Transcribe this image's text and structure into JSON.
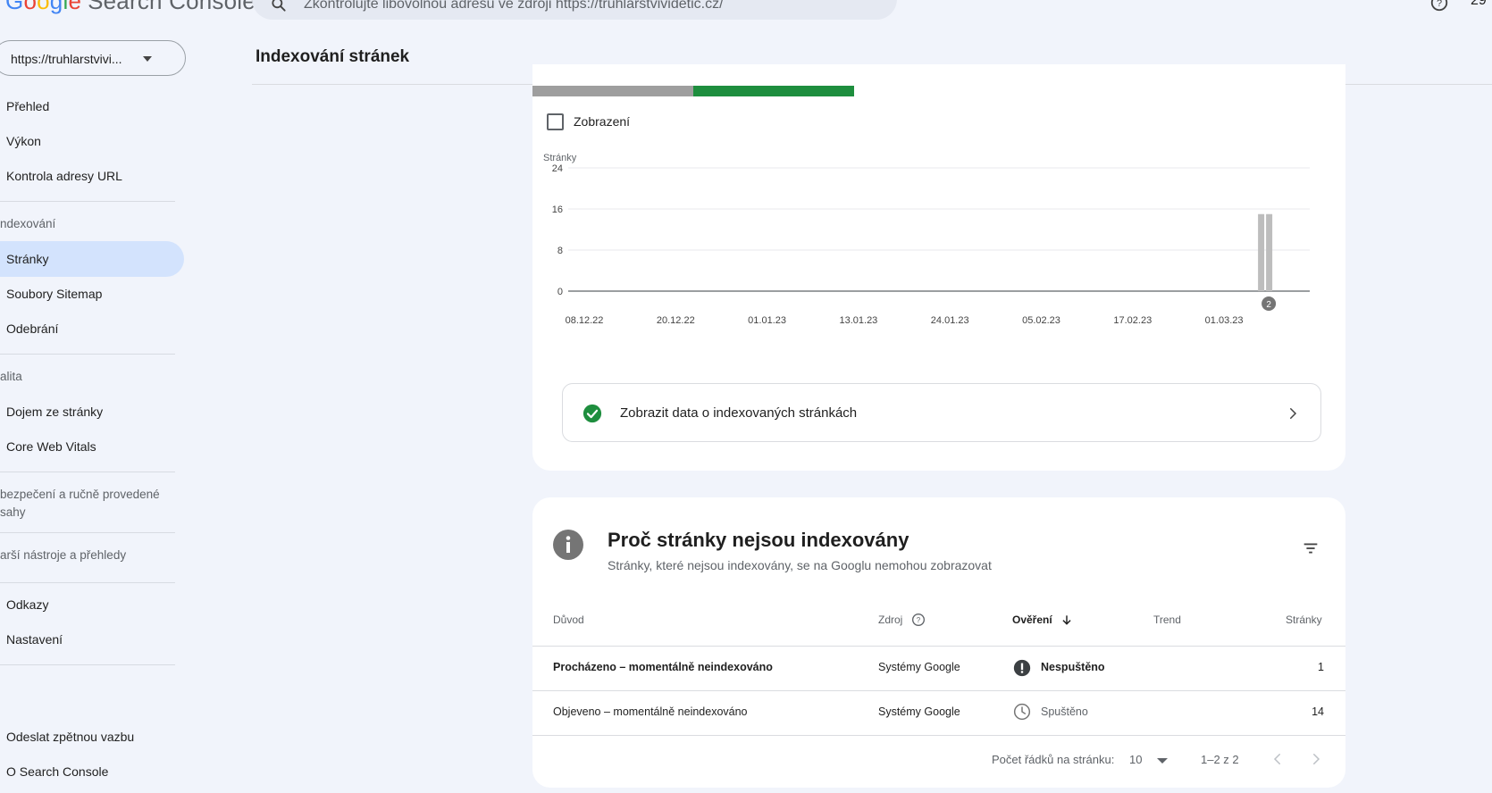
{
  "app": {
    "logo_letters": [
      "G",
      "o",
      "o",
      "g",
      "l",
      "e"
    ],
    "logo_rest": "Search Console",
    "search_placeholder": "Zkontrolujte libovolnou adresu ve zdroji https://truhlarstvividetic.cz/",
    "account_text": "29"
  },
  "sidebar": {
    "property": "https://truhlarstvivi...",
    "items": {
      "prehled": "Přehled",
      "vykon": "Výkon",
      "kontrola": "Kontrola adresy URL",
      "section_indexovani": "ndexování",
      "stranky": "Stránky",
      "sitemap": "Soubory Sitemap",
      "odebrani": "Odebrání",
      "section_kvalita": "alita",
      "dojem": "Dojem ze stránky",
      "cwv": "Core Web Vitals",
      "section_zabezpeceni": "bezpečení a ručně provedené\nsahy",
      "section_nastroje": "arší nástroje a přehledy",
      "odkazy": "Odkazy",
      "nastaveni": "Nastavení",
      "zpetna_vazba": "Odeslat zpětnou vazbu",
      "o_sc": "O Search Console"
    }
  },
  "header": {
    "title": "Indexování stránek"
  },
  "chart_card": {
    "checkbox_label": "Zobrazení",
    "link_text": "Zobrazit data o indexovaných stránkách"
  },
  "chart_data": {
    "type": "bar",
    "ylabel": "Stránky",
    "yticks": [
      0,
      8,
      16,
      24
    ],
    "ylim": [
      0,
      24
    ],
    "xticks": [
      "08.12.22",
      "20.12.22",
      "01.01.23",
      "13.01.23",
      "24.01.23",
      "05.02.23",
      "17.02.23",
      "01.03.23"
    ],
    "bars": [
      {
        "x": "10.03.23",
        "value": 15
      },
      {
        "x": "11.03.23",
        "value": 15
      }
    ],
    "annotation": "2",
    "grid": true,
    "colors": {
      "bar": "#bdbdbd",
      "axis": "#5f6368",
      "annotation_bg": "#757575"
    }
  },
  "table_card": {
    "title": "Proč stránky nejsou indexovány",
    "subtitle": "Stránky, které nejsou indexovány, se na Googlu nemohou zobrazovat",
    "headers": {
      "reason": "Důvod",
      "source": "Zdroj",
      "validation": "Ověření",
      "trend": "Trend",
      "pages": "Stránky"
    },
    "rows": [
      {
        "reason": "Procházeno – momentálně neindexováno",
        "source": "Systémy Google",
        "validation": "Nespuštěno",
        "pages": "1"
      },
      {
        "reason": "Objeveno – momentálně neindexováno",
        "source": "Systémy Google",
        "validation": "Spuštěno",
        "pages": "14"
      }
    ],
    "pagination": {
      "label": "Počet řádků na stránku:",
      "rows_value": "10",
      "range": "1–2 z 2"
    }
  }
}
